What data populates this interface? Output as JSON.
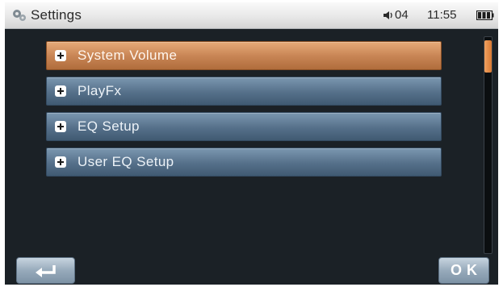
{
  "status_bar": {
    "title": "Settings",
    "settings_icon": "gears-icon",
    "volume_icon": "speaker-icon",
    "volume_level": "04",
    "time": "11:55",
    "battery_icon": "battery-icon"
  },
  "menu": {
    "items": [
      {
        "label": "System Volume",
        "icon": "plus-icon",
        "selected": true
      },
      {
        "label": "PlayFx",
        "icon": "plus-icon",
        "selected": false
      },
      {
        "label": "EQ Setup",
        "icon": "plus-icon",
        "selected": false
      },
      {
        "label": "User EQ Setup",
        "icon": "plus-icon",
        "selected": false
      }
    ]
  },
  "scrollbar": {
    "position_fraction": 0.0
  },
  "buttons": {
    "back_icon": "back-arrow-icon",
    "ok_label": "OK"
  },
  "colors": {
    "selected_item": "#c98656",
    "item": "#55708a",
    "background": "#1b2126",
    "scroll_thumb": "#e38b45"
  }
}
